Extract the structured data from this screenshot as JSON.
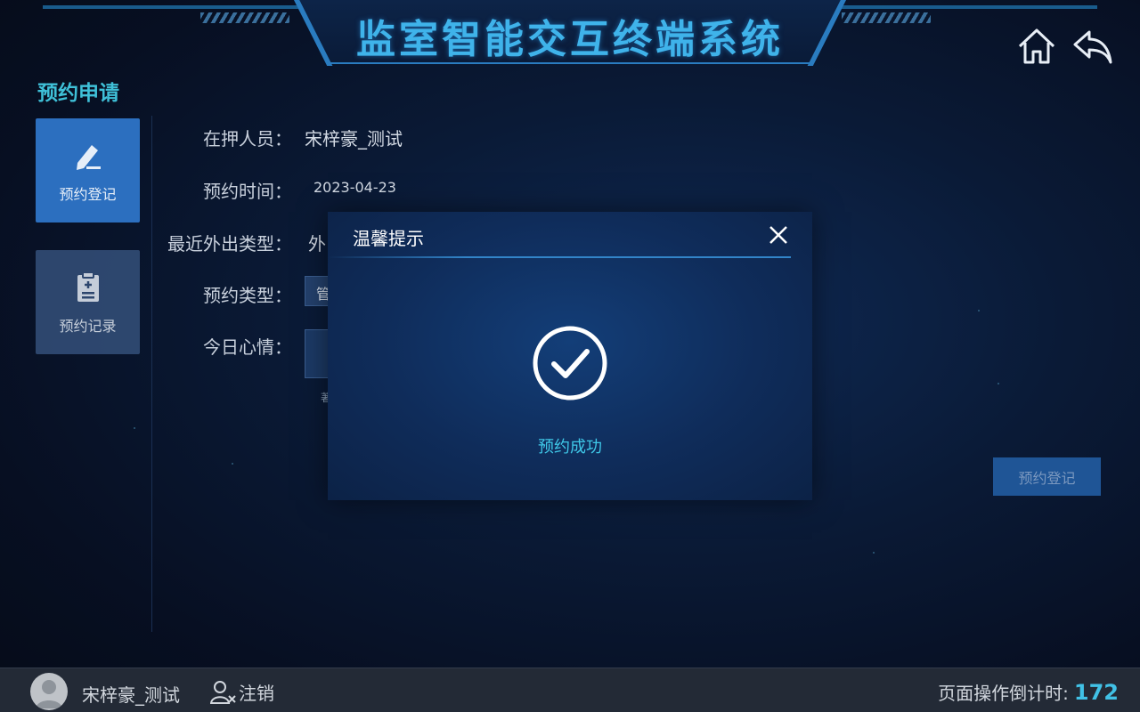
{
  "header": {
    "title": "监室智能交互终端系统"
  },
  "sidebar": {
    "section_title": "预约申请",
    "items": [
      {
        "label": "预约登记",
        "icon": "pen-icon",
        "active": true
      },
      {
        "label": "预约记录",
        "icon": "clipboard-icon",
        "active": false
      }
    ]
  },
  "form": {
    "detainee_label": "在押人员：",
    "detainee_value": "宋梓豪_测试",
    "date_label": "预约时间：",
    "date_value": "2023-04-23",
    "last_out_label": "最近外出类型：",
    "last_out_value": "外",
    "type_label": "预约类型：",
    "type_value": "管",
    "mood_label": "今日心情：",
    "mood_caption": "著",
    "submit_label": "预约登记"
  },
  "modal": {
    "title": "温馨提示",
    "message": "预约成功"
  },
  "footer": {
    "user_name": "宋梓豪_测试",
    "logout_label": "注销",
    "countdown_label": "页面操作倒计时:",
    "countdown_value": "172"
  },
  "colors": {
    "accent": "#3fc0d8",
    "active_tab": "#2c6fbf",
    "submit_bg": "#1f5596",
    "footer_bg": "#232a36"
  }
}
